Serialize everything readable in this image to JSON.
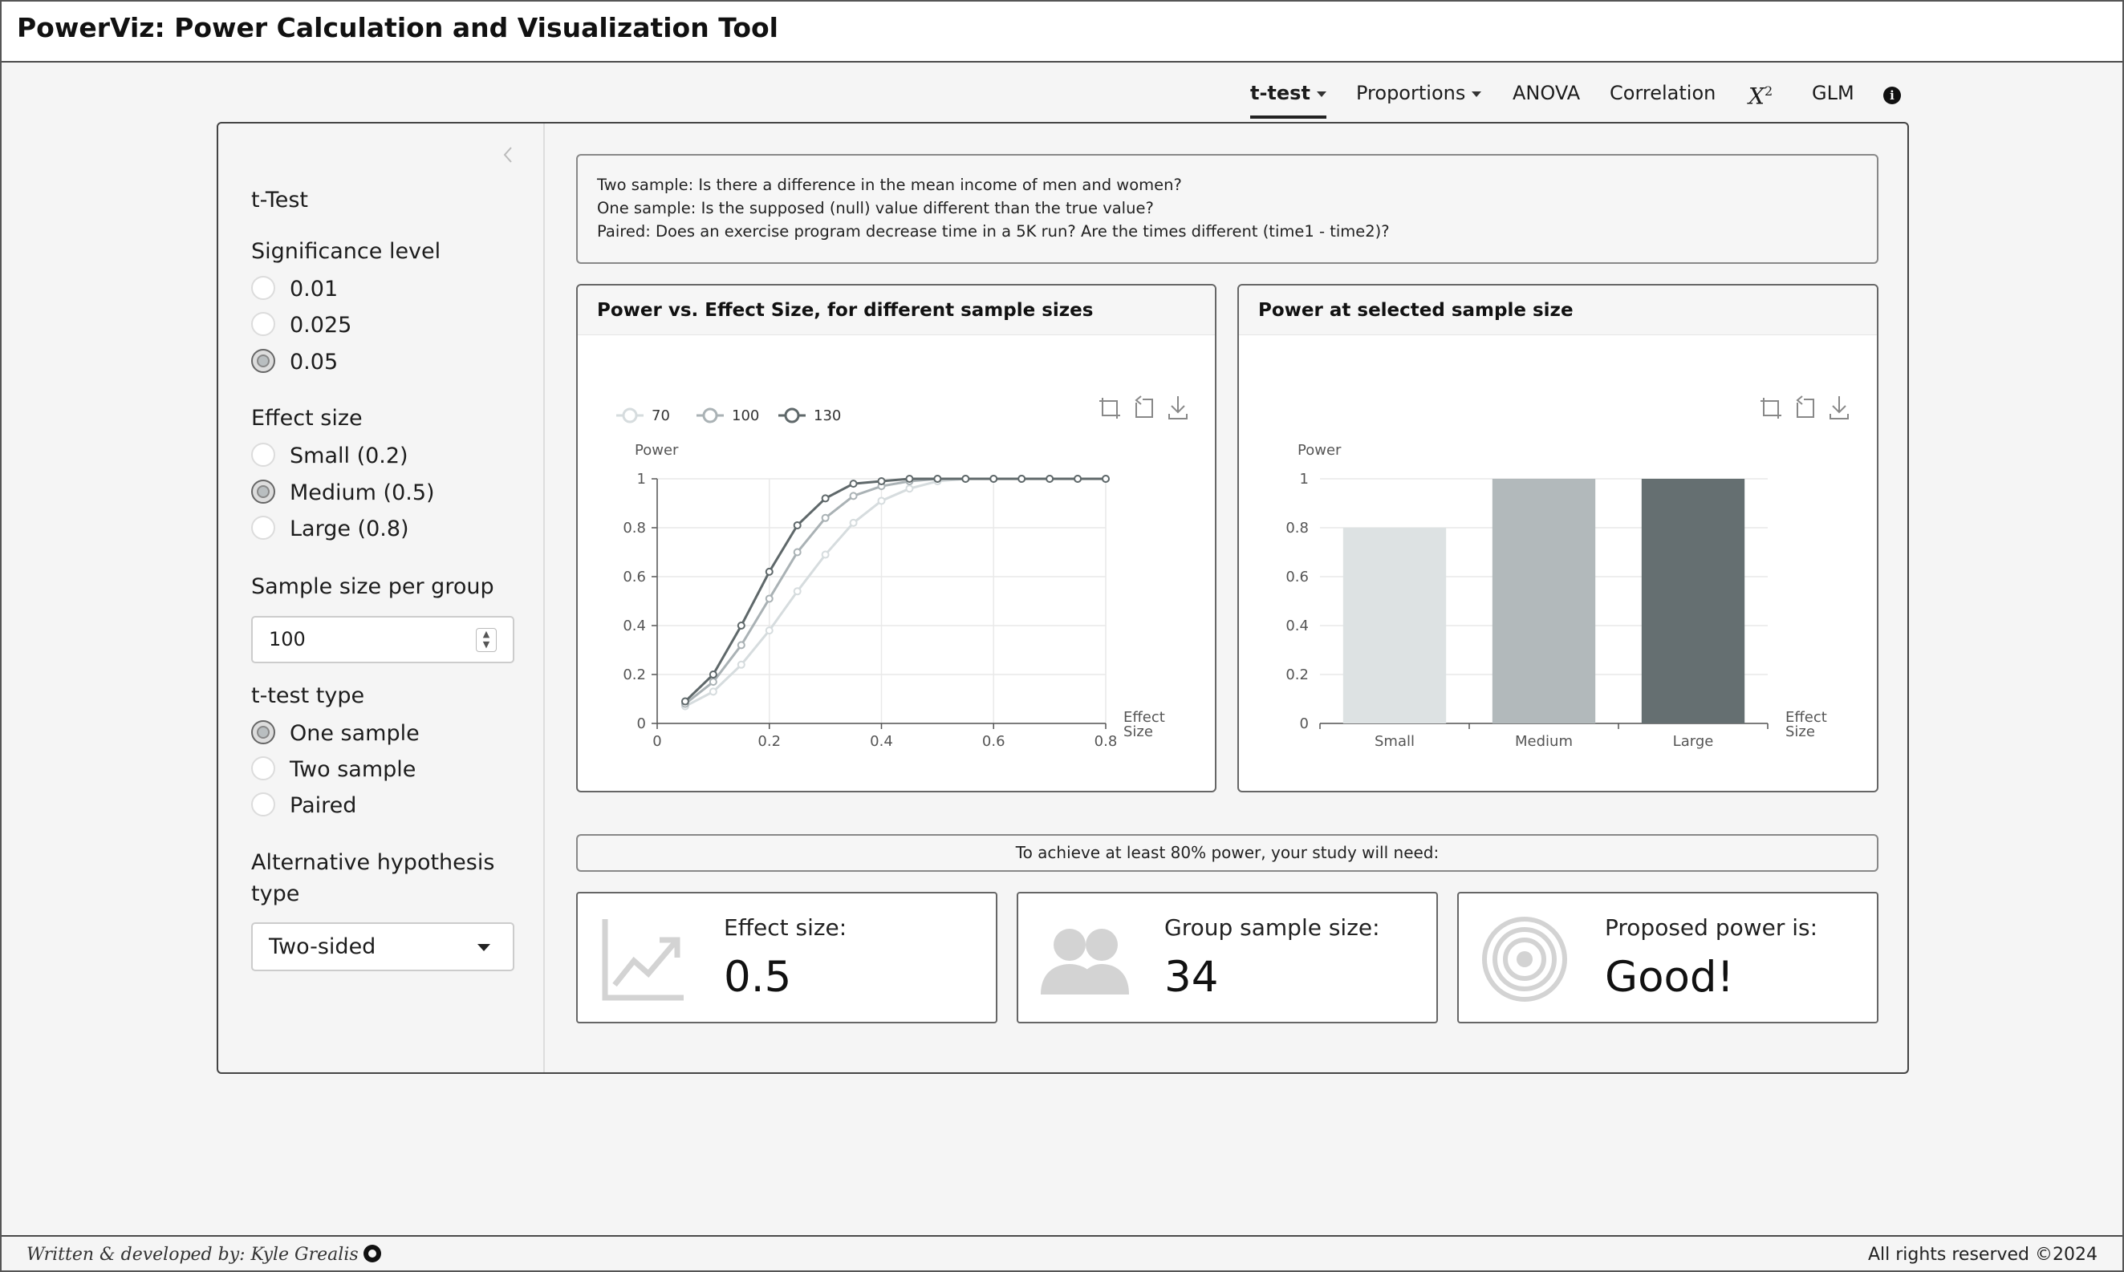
{
  "app": {
    "title": "PowerViz: Power Calculation and Visualization Tool"
  },
  "nav": {
    "items": [
      {
        "label": "t-test",
        "dropdown": true,
        "active": true
      },
      {
        "label": "Proportions",
        "dropdown": true,
        "active": false
      },
      {
        "label": "ANOVA",
        "dropdown": false,
        "active": false
      },
      {
        "label": "Correlation",
        "dropdown": false,
        "active": false
      },
      {
        "label": "X",
        "sup": "2",
        "dropdown": false,
        "active": false
      },
      {
        "label": "GLM",
        "dropdown": false,
        "active": false
      }
    ],
    "info_icon": "info-circle-icon"
  },
  "sidebar": {
    "title": "t-Test",
    "significance": {
      "label": "Significance level",
      "options": [
        "0.01",
        "0.025",
        "0.05"
      ],
      "selected": "0.05"
    },
    "effect": {
      "label": "Effect size",
      "options": [
        "Small (0.2)",
        "Medium (0.5)",
        "Large (0.8)"
      ],
      "selected": "Medium (0.5)"
    },
    "sample": {
      "label": "Sample size per group",
      "value": "100"
    },
    "ttype": {
      "label": "t-test type",
      "options": [
        "One sample",
        "Two sample",
        "Paired"
      ],
      "selected": "One sample"
    },
    "alt": {
      "label_line1": "Alternative hypothesis",
      "label_line2": "type",
      "value": "Two-sided"
    }
  },
  "description": {
    "lines": [
      "Two sample: Is there a difference in the mean income of men and women?",
      "One sample: Is the supposed (null) value different than the true value?",
      "Paired: Does an exercise program decrease time in a 5K run? Are the times different (time1 - time2)?"
    ]
  },
  "line_chart": {
    "title": "Power vs. Effect Size, for different sample sizes"
  },
  "bar_chart": {
    "title": "Power at selected sample size"
  },
  "chart_data": [
    {
      "type": "line",
      "title": "Power vs. Effect Size, for different sample sizes",
      "ylabel": "Power",
      "xlabel": "Effect Size",
      "xlim": [
        0,
        0.8
      ],
      "ylim": [
        0,
        1
      ],
      "xticks": [
        "0",
        "0.2",
        "0.4",
        "0.6",
        "0.8"
      ],
      "yticks": [
        "0",
        "0.2",
        "0.4",
        "0.6",
        "0.8",
        "1"
      ],
      "legend": "top-left",
      "grid": true,
      "x": [
        0.05,
        0.1,
        0.15,
        0.2,
        0.25,
        0.3,
        0.35,
        0.4,
        0.45,
        0.5,
        0.55,
        0.6,
        0.65,
        0.7,
        0.75,
        0.8
      ],
      "series": [
        {
          "name": "70",
          "color": "#d6dcde",
          "values": [
            0.07,
            0.13,
            0.24,
            0.38,
            0.54,
            0.69,
            0.82,
            0.91,
            0.96,
            0.99,
            1,
            1,
            1,
            1,
            1,
            1
          ]
        },
        {
          "name": "100",
          "color": "#aab2b5",
          "values": [
            0.08,
            0.17,
            0.32,
            0.51,
            0.7,
            0.84,
            0.93,
            0.97,
            0.99,
            1,
            1,
            1,
            1,
            1,
            1,
            1
          ]
        },
        {
          "name": "130",
          "color": "#5f686a",
          "values": [
            0.09,
            0.2,
            0.4,
            0.62,
            0.81,
            0.92,
            0.98,
            0.99,
            1,
            1,
            1,
            1,
            1,
            1,
            1,
            1
          ]
        }
      ],
      "toolbox": [
        "zoom-icon",
        "zoom-reset-icon",
        "download-icon"
      ]
    },
    {
      "type": "bar",
      "title": "Power at selected sample size",
      "ylabel": "Power",
      "xlabel": "Effect Size",
      "ylim": [
        0,
        1
      ],
      "yticks": [
        "0",
        "0.2",
        "0.4",
        "0.6",
        "0.8",
        "1"
      ],
      "categories": [
        "Small",
        "Medium",
        "Large"
      ],
      "values": [
        0.8,
        1,
        1
      ],
      "colors": [
        "#dde2e3",
        "#b2b9bb",
        "#656f71"
      ],
      "toolbox": [
        "zoom-icon",
        "zoom-reset-icon",
        "download-icon"
      ]
    }
  ],
  "results": {
    "message": "To achieve at least 80% power, your study will need:",
    "boxes": [
      {
        "title": "Effect size:",
        "value": "0.5",
        "icon": "chart-line-icon"
      },
      {
        "title": "Group sample size:",
        "value": "34",
        "icon": "users-icon"
      },
      {
        "title": "Proposed power is:",
        "value": "Good!",
        "icon": "bullseye-icon"
      }
    ]
  },
  "footer": {
    "left": "Written & developed by: Kyle Grealis",
    "right": "All rights reserved ©2024",
    "icon": "github-icon"
  }
}
